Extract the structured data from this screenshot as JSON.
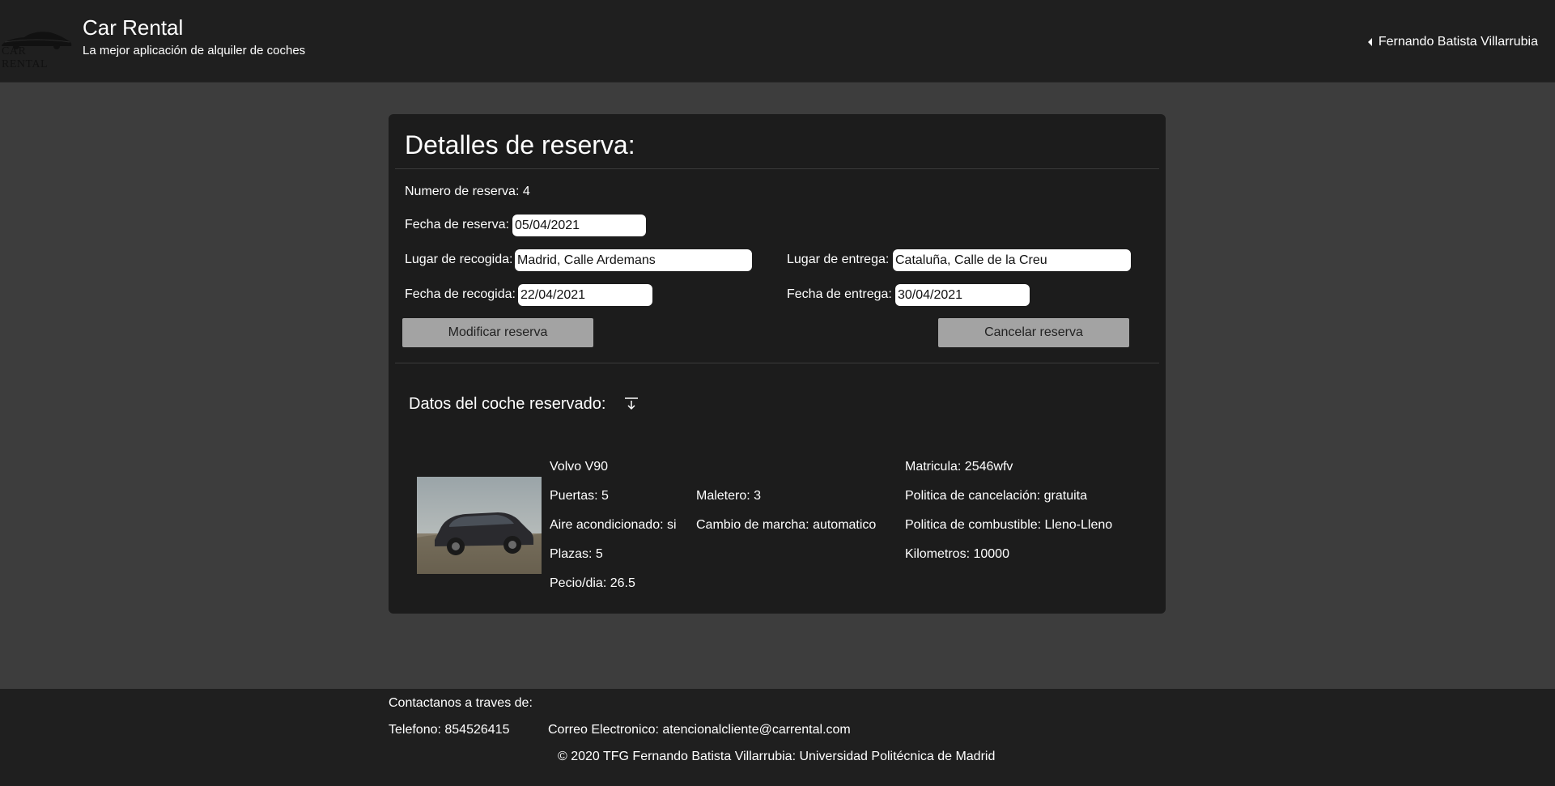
{
  "header": {
    "logo_text": "CAR RENTAL",
    "title": "Car Rental",
    "subtitle": "La mejor aplicación de alquiler de coches",
    "user_name": "Fernando Batista Villarrubia"
  },
  "reservation": {
    "heading": "Detalles de reserva:",
    "number_label": "Numero de reserva: 4",
    "booking_date_label": "Fecha de reserva:",
    "booking_date_value": "05/04/2021",
    "pickup_place_label": "Lugar de recogida:",
    "pickup_place_value": "Madrid, Calle Ardemans",
    "delivery_place_label": "Lugar de entrega:",
    "delivery_place_value": "Cataluña, Calle de la Creu",
    "pickup_date_label": "Fecha de recogida:",
    "pickup_date_value": "22/04/2021",
    "delivery_date_label": "Fecha de entrega:",
    "delivery_date_value": "30/04/2021",
    "modify_button": "Modificar reserva",
    "cancel_button": "Cancelar reserva"
  },
  "car": {
    "section_title": "Datos del coche reservado:",
    "model": "Volvo V90",
    "doors": "Puertas: 5",
    "air_conditioning": "Aire acondicionado: si",
    "seats": "Plazas: 5",
    "price_per_day": "Pecio/dia: 26.5",
    "trunk": "Maletero: 3",
    "gearbox": "Cambio de marcha: automatico",
    "plate": "Matricula: 2546wfv",
    "cancellation_policy": "Politica de cancelación: gratuita",
    "fuel_policy": "Politica de combustible: Lleno-Lleno",
    "kilometers": "Kilometros: 10000"
  },
  "footer": {
    "contact_heading": "Contactanos a traves de:",
    "phone": "Telefono: 854526415",
    "email": "Correo Electronico: atencionalcliente@carrental.com",
    "copyright": "© 2020 TFG Fernando Batista Villarrubia: Universidad Politécnica de Madrid"
  },
  "colors": {
    "page_background": "#3d3d3d",
    "panel_background": "#1c1c1c",
    "header_background": "#1f1f1f",
    "button_background": "#a3a3a3"
  },
  "icons": {
    "user_menu": "caret-left-icon",
    "section_toggle": "download-arrow-icon"
  }
}
